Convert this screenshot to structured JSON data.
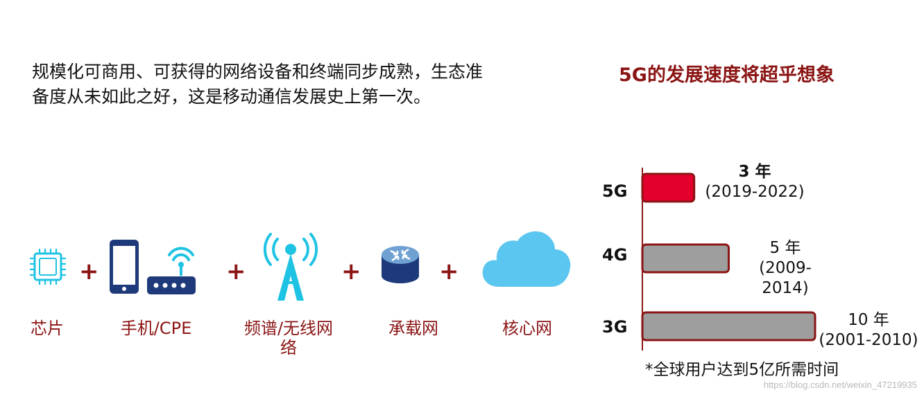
{
  "headline": {
    "line1": "规模化可商用、可获得的网络设备和终端同步成熟，生态准",
    "line2": "备度从未如此之好，这是移动通信发展史上第一次。"
  },
  "components": [
    {
      "label": "芯片",
      "icon": "chip-icon"
    },
    {
      "label": "手机/CPE",
      "icon": "phone-router-icon"
    },
    {
      "label_line1": "频谱/无线网",
      "label_line2": "络",
      "icon": "antenna-icon"
    },
    {
      "label": "承载网",
      "icon": "router-icon"
    },
    {
      "label": "核心网",
      "icon": "cloud-icon"
    }
  ],
  "plus_sign": "+",
  "chart_data": {
    "type": "bar",
    "orientation": "horizontal",
    "title": "5G的发展速度将超乎想象",
    "categories": [
      "5G",
      "4G",
      "3G"
    ],
    "values": [
      3,
      5,
      10
    ],
    "value_labels": [
      {
        "years": "3 年",
        "range": "(2019-2022)"
      },
      {
        "years": "5 年",
        "range_line1": "(2009-",
        "range_line2": "2014)"
      },
      {
        "years": "10 年",
        "range": "(2001-2010)"
      }
    ],
    "xlim": [
      0,
      10
    ],
    "colors": [
      "#e3002c",
      "#9e9e9e",
      "#9e9e9e"
    ],
    "edge_color": "#8b1414",
    "grid": false,
    "footnote": "*全球用户达到5亿所需时间"
  },
  "watermark": "https://blog.csdn.net/weixin_47219935"
}
